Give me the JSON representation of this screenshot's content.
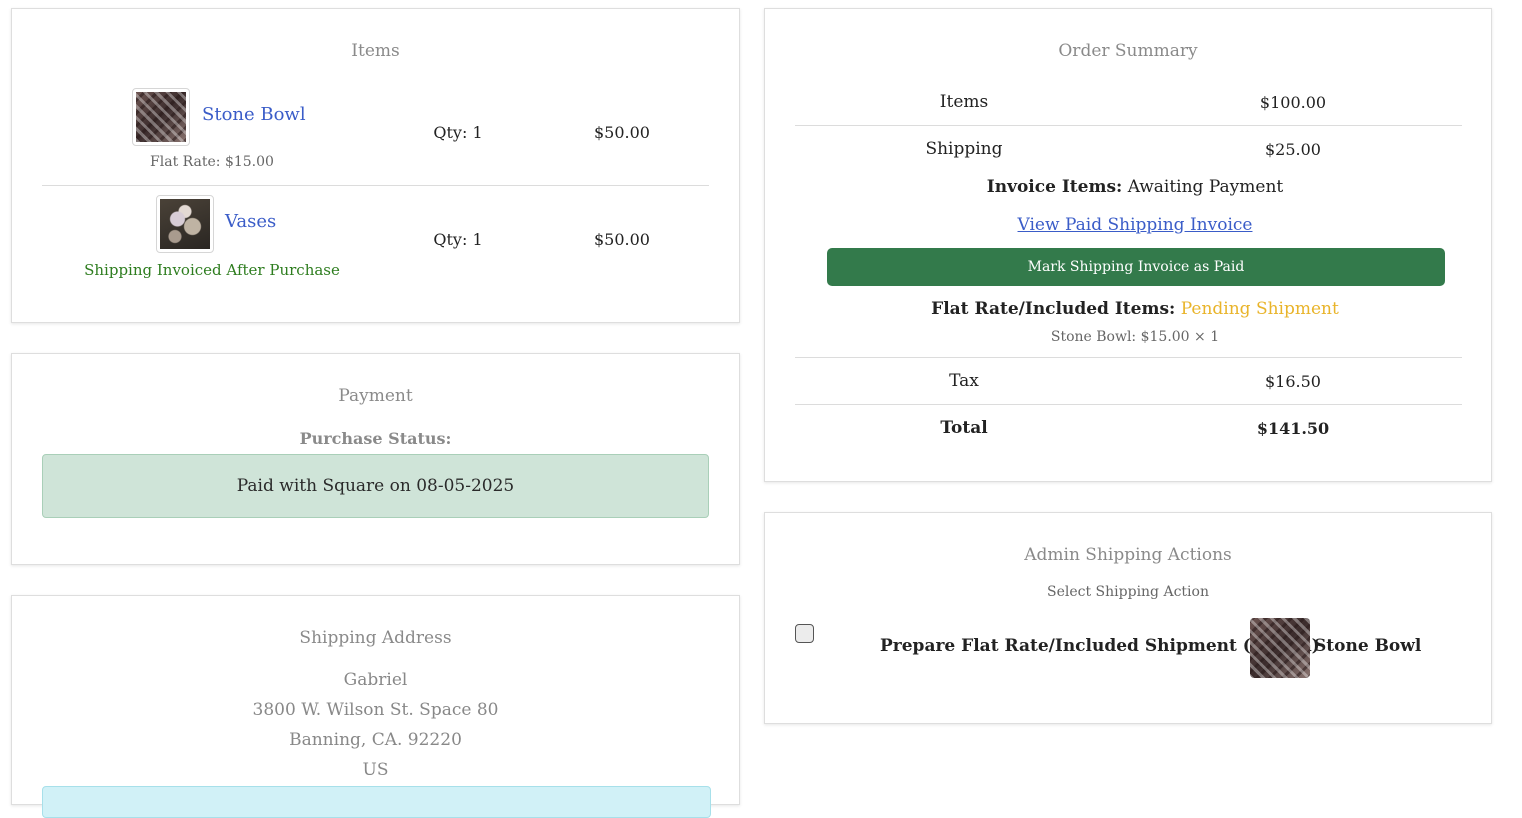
{
  "items": {
    "title": "Items",
    "rows": [
      {
        "name": "Stone Bowl",
        "note": "Flat Rate: $15.00",
        "qty": "Qty: 1",
        "price": "$50.00",
        "thumb_icon": "stone-bowl-thumbnail"
      },
      {
        "name": "Vases",
        "note": "Shipping Invoiced After Purchase",
        "qty": "Qty: 1",
        "price": "$50.00",
        "thumb_icon": "vases-thumbnail"
      }
    ]
  },
  "payment": {
    "title": "Payment",
    "status_label": "Purchase Status:",
    "status_text": "Paid with Square on 08-05-2025"
  },
  "shipping_address": {
    "title": "Shipping Address",
    "lines": [
      "Gabriel",
      "3800 W. Wilson St. Space 80",
      "Banning, CA. 92220",
      "US"
    ]
  },
  "order_summary": {
    "title": "Order Summary",
    "items_label": "Items",
    "items_value": "$100.00",
    "shipping_label": "Shipping",
    "shipping_value": "$25.00",
    "invoice_items_label": "Invoice Items:",
    "invoice_items_status": "Awaiting Payment",
    "view_invoice_link": "View Paid Shipping Invoice",
    "mark_paid_button": "Mark Shipping Invoice as Paid",
    "flat_rate_label": "Flat Rate/Included Items:",
    "flat_rate_status": "Pending Shipment",
    "flat_rate_detail": "Stone Bowl: $15.00 × 1",
    "tax_label": "Tax",
    "tax_value": "$16.50",
    "total_label": "Total",
    "total_value": "$141.50"
  },
  "admin_shipping": {
    "title": "Admin Shipping Actions",
    "subtitle": "Select Shipping Action",
    "action_label": "Prepare Flat Rate/Included Shipment (1 item)",
    "action_item_name": "Stone Bowl",
    "action_checked": false
  },
  "colors": {
    "link": "#3a5cc8",
    "success_green": "#337a4b",
    "note_green": "#2e7d1f",
    "pending": "#e9b42a",
    "paid_box_bg": "#cfe4d8",
    "info_strip_bg": "#d1f1f7"
  }
}
